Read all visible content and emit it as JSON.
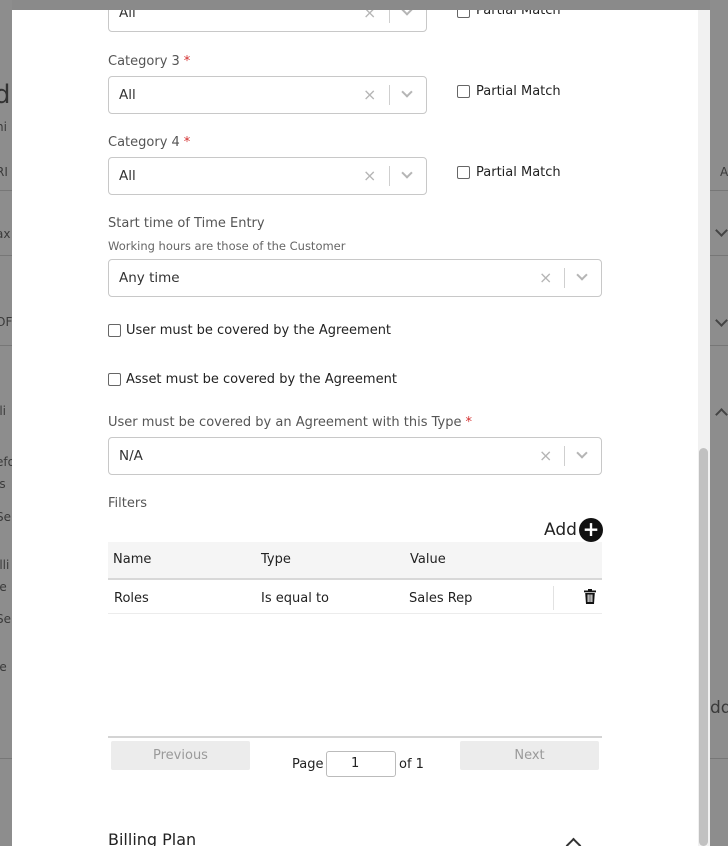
{
  "background": {
    "fragments": [
      "d",
      "hi",
      "RI",
      "ax",
      "OF",
      "lli",
      "efo",
      "is",
      "Se",
      "illi",
      "le",
      "Se",
      "ie",
      "A",
      "dd"
    ]
  },
  "form": {
    "category2": {
      "value": "All",
      "partial_label": "Partial Match"
    },
    "category3": {
      "label": "Category 3",
      "required": "*",
      "value": "All",
      "partial_label": "Partial Match"
    },
    "category4": {
      "label": "Category 4",
      "required": "*",
      "value": "All",
      "partial_label": "Partial Match"
    },
    "start_time": {
      "label": "Start time of Time Entry",
      "hint": "Working hours are those of the Customer",
      "value": "Any time"
    },
    "user_covered": {
      "label": "User must be covered by the Agreement"
    },
    "asset_covered": {
      "label": "Asset must be covered by the Agreement"
    },
    "agreement_type": {
      "label": "User must be covered by an Agreement with this Type",
      "required": "*",
      "value": "N/A"
    },
    "clear_glyph": "×"
  },
  "filters": {
    "label": "Filters",
    "add_label": "Add",
    "add_glyph": "+",
    "columns": [
      "Name",
      "Type",
      "Value"
    ],
    "rows": [
      {
        "name": "Roles",
        "type": "Is equal to",
        "value": "Sales Rep"
      }
    ]
  },
  "pager": {
    "previous": "Previous",
    "next": "Next",
    "page_label": "Page",
    "page_value": "1",
    "of_label": "of 1"
  },
  "billing_plan": {
    "title": "Billing Plan"
  }
}
